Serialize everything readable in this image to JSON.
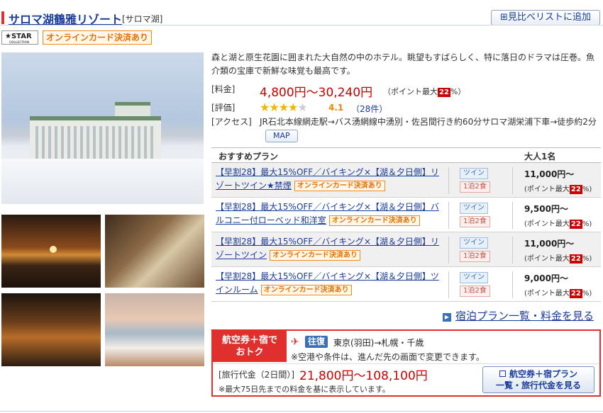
{
  "hotel": {
    "name": "サロマ湖鶴雅リゾート",
    "area": "[サロマ湖]",
    "compare_button": "⊞見比べリストに追加",
    "star_badge": "★STAR",
    "star_badge_sub": "COLLECTION",
    "card_badge": "オンラインカード決済あり"
  },
  "info": {
    "description": "森と湖と原生花園に囲まれた大自然の中のホテル。眺望もすばらしく、特に落日のドラマは圧巻。魚介類の宝庫で新鮮な味覚も最高です。",
    "price_label": "[料金]",
    "price": "4,800円〜30,240円",
    "point_prefix": "（ポイント最大",
    "point_value": "22",
    "point_suffix": "%）",
    "rating_label": "[評価]",
    "rating": "4.1",
    "rating_value": 4.1,
    "reviews": "（28件）",
    "access_label": "[アクセス]",
    "access": "JR石北本線網走駅→バス湧網線中湧別・佐呂間行き約60分サロマ湖栄浦下車→徒歩約2分",
    "map_button": "MAP"
  },
  "plans": {
    "header_plan": "おすすめプラン",
    "header_price": "大人1名",
    "card_badge": "オンラインカード決済あり",
    "point_prefix": "(ポイント最大",
    "point_value": "22",
    "point_suffix": "%)",
    "rows": [
      {
        "title": "【早割28】最大15%OFF／バイキング×【湖＆夕日側】リゾートツイン★禁煙",
        "room": "ツイン",
        "meal": "1泊2食",
        "price": "11,000円〜"
      },
      {
        "title": "【早割28】最大15%OFF／バイキング×【湖＆夕日側】バルコニー付ローベッド和洋室",
        "room": "ツイン",
        "meal": "1泊2食",
        "price": "9,500円〜"
      },
      {
        "title": "【早割28】最大15%OFF／バイキング×【湖＆夕日側】リゾートツイン",
        "room": "ツイン",
        "meal": "1泊2食",
        "price": "11,000円〜"
      },
      {
        "title": "【早割28】最大15%OFF／バイキング×【湖＆夕日側】ツインルーム",
        "room": "ツイン",
        "meal": "1泊2食",
        "price": "9,000円〜"
      }
    ],
    "more_link": "宿泊プラン一覧・料金を見る"
  },
  "air": {
    "title_line1": "航空券＋宿で",
    "title_line2": "おトク",
    "trip_type": "往復",
    "route": "東京(羽田)→札幌・千歳",
    "note": "※空港や条件は、進んだ先の画面で変更できます。",
    "fee_label": "[旅行代金（2日間）]",
    "fee": "21,800円〜108,100円",
    "fee_note": "※最大75日先までの料金を基に表示しています。",
    "button_line1": "航空券＋宿プラン",
    "button_line2": "一覧・旅行代金を見る"
  }
}
